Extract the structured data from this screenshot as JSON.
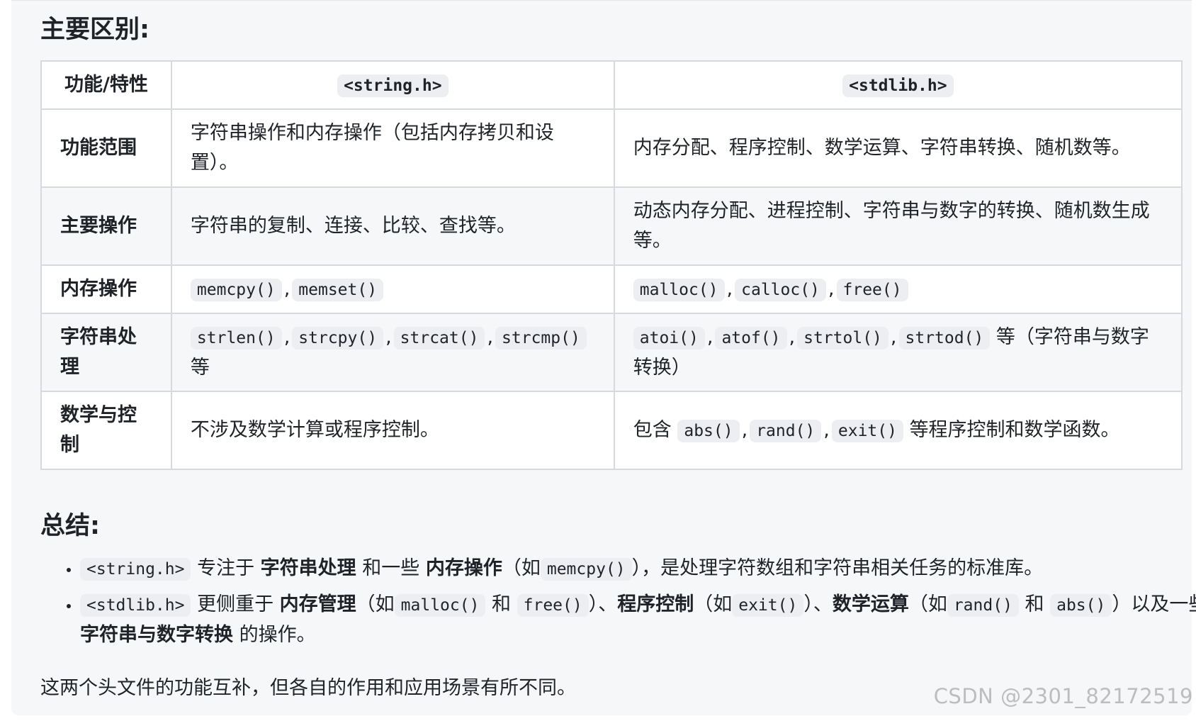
{
  "headings": {
    "diff": "主要区别:",
    "summary": "总结:"
  },
  "table": {
    "headers": [
      "功能/特性",
      "<string.h>",
      "<stdlib.h>"
    ],
    "rows": [
      {
        "feature": "功能范围",
        "string_h": "字符串操作和内存操作（包括内存拷贝和设置）。",
        "stdlib_h": "内存分配、程序控制、数学运算、字符串转换、随机数等。"
      },
      {
        "feature": "主要操作",
        "string_h": "字符串的复制、连接、比较、查找等。",
        "stdlib_h": "动态内存分配、进程控制、字符串与数字的转换、随机数生成等。"
      },
      {
        "feature": "内存操作",
        "string_h_codes": [
          "memcpy()",
          "memset()"
        ],
        "stdlib_h_codes": [
          "malloc()",
          "calloc()",
          "free()"
        ]
      },
      {
        "feature": "字符串处理",
        "string_h_codes": [
          "strlen()",
          "strcpy()",
          "strcat()",
          "strcmp()"
        ],
        "string_h_suffix": "等",
        "stdlib_h_codes": [
          "atoi()",
          "atof()",
          "strtol()",
          "strtod()"
        ],
        "stdlib_h_suffix": "等（字符串与数字转换）"
      },
      {
        "feature": "数学与控制",
        "string_h": "不涉及数学计算或程序控制。",
        "stdlib_h_prefix": "包含",
        "stdlib_h_codes": [
          "abs()",
          "rand()",
          "exit()"
        ],
        "stdlib_h_suffix": "等程序控制和数学函数。"
      }
    ],
    "separator": ","
  },
  "summary": {
    "item1": {
      "code1": "<string.h>",
      "t1": "专注于",
      "b1": "字符串处理",
      "t2": "和一些",
      "b2": "内存操作",
      "t3": "（如",
      "code2": "memcpy()",
      "t4": "），是处理字符数组和字符串相关任务的标准库。"
    },
    "item2": {
      "code1": "<stdlib.h>",
      "t1": "更侧重于",
      "b1": "内存管理",
      "t2": "（如",
      "code2": "malloc()",
      "t3": "和",
      "code3": "free()",
      "t4": "）、",
      "b2": "程序控制",
      "t5": "（如",
      "code4": "exit()",
      "t6": "）、",
      "b3": "数学运算",
      "t7": "（如",
      "code5": "rand()",
      "t8": "和",
      "code6": "abs()",
      "t9": "）以及一些",
      "b4": "字符串与数字转换",
      "t10": "的操作。"
    }
  },
  "conclusion": "这两个头文件的功能互补，但各自的作用和应用场景有所不同。",
  "watermark": "CSDN @2301_82172519"
}
